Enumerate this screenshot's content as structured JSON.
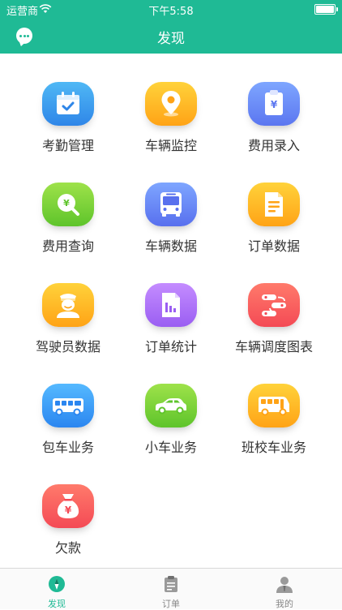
{
  "status_bar": {
    "carrier": "运营商",
    "time": "下午5:58"
  },
  "header": {
    "title": "发现"
  },
  "features": [
    {
      "label": "考勤管理",
      "icon": "calendar-check-icon",
      "color_top": "#4fb8f5",
      "color_bottom": "#2f86e8"
    },
    {
      "label": "车辆监控",
      "icon": "location-pin-icon",
      "color_top": "#ffd23a",
      "color_bottom": "#ffa316"
    },
    {
      "label": "费用录入",
      "icon": "clipboard-yen-icon",
      "color_top": "#7ea6ff",
      "color_bottom": "#5b76f0"
    },
    {
      "label": "费用查询",
      "icon": "yen-search-icon",
      "color_top": "#9ee24a",
      "color_bottom": "#5ec42b"
    },
    {
      "label": "车辆数据",
      "icon": "bus-front-icon",
      "color_top": "#7ea6ff",
      "color_bottom": "#5870ee"
    },
    {
      "label": "订单数据",
      "icon": "document-icon",
      "color_top": "#ffd23a",
      "color_bottom": "#ffa316"
    },
    {
      "label": "驾驶员数据",
      "icon": "driver-icon",
      "color_top": "#ffd23a",
      "color_bottom": "#ffa316"
    },
    {
      "label": "订单统计",
      "icon": "bar-chart-doc-icon",
      "color_top": "#c48cff",
      "color_bottom": "#9a5ef2"
    },
    {
      "label": "车辆调度图表",
      "icon": "schedule-flow-icon",
      "color_top": "#ff7a6b",
      "color_bottom": "#f44a55"
    },
    {
      "label": "包车业务",
      "icon": "coach-bus-icon",
      "color_top": "#55b9ff",
      "color_bottom": "#2b86f0"
    },
    {
      "label": "小车业务",
      "icon": "car-icon",
      "color_top": "#9ee24a",
      "color_bottom": "#5ec42b"
    },
    {
      "label": "班校车业务",
      "icon": "school-bus-icon",
      "color_top": "#ffd23a",
      "color_bottom": "#ffa316"
    },
    {
      "label": "欠款",
      "icon": "money-bag-icon",
      "color_top": "#ff7a6b",
      "color_bottom": "#f44a55"
    }
  ],
  "tabbar": {
    "items": [
      {
        "label": "发现",
        "icon": "compass-icon",
        "active": true
      },
      {
        "label": "订单",
        "icon": "clipboard-icon",
        "active": false
      },
      {
        "label": "我的",
        "icon": "profile-icon",
        "active": false
      }
    ],
    "active_color": "#1fba95",
    "inactive_color": "#888888"
  },
  "accent_color": "#1fba95"
}
